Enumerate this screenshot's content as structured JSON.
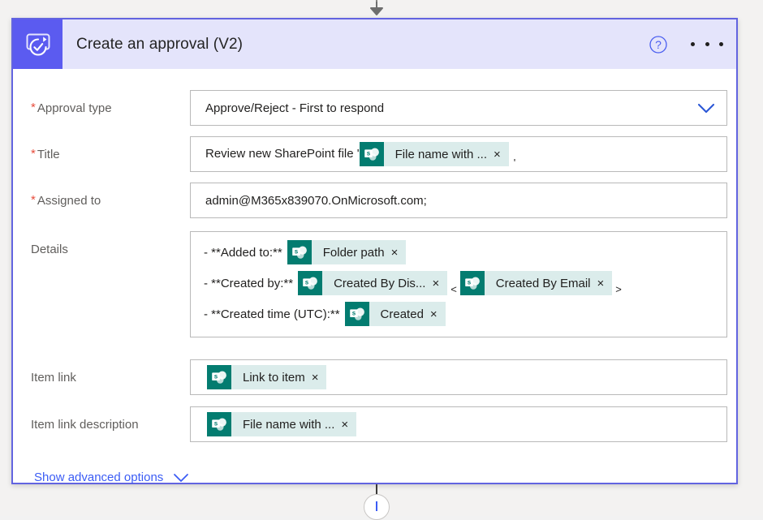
{
  "header": {
    "title": "Create an approval (V2)",
    "icon": "approvals-icon",
    "help_icon": "help-circle-icon",
    "more_icon": "more-horizontal-icon",
    "bg_color": "#e4e4fb",
    "icon_bg_color": "#5b5bf0"
  },
  "card": {
    "border_color": "#6264e0",
    "background": "#ffffff"
  },
  "fields": {
    "approval_type": {
      "label": "Approval type",
      "required": true,
      "value": "Approve/Reject - First to respond",
      "chevron_icon": "chevron-down-icon"
    },
    "title": {
      "label": "Title",
      "required": true,
      "prefix_text": "Review new SharePoint file '",
      "token": {
        "label": "File name with ...",
        "icon": "sharepoint-icon",
        "remove": "×"
      },
      "suffix_text": "'"
    },
    "assigned_to": {
      "label": "Assigned to",
      "required": true,
      "value": "admin@M365x839070.OnMicrosoft.com;"
    },
    "details": {
      "label": "Details",
      "required": false,
      "lines": [
        {
          "lead": "- **Added to:**",
          "tokens": [
            {
              "label": "Folder path",
              "icon": "sharepoint-icon",
              "remove": "×"
            }
          ],
          "between": "",
          "trailing": ""
        },
        {
          "lead": "- **Created by:**",
          "tokens": [
            {
              "label": "Created By Dis...",
              "icon": "sharepoint-icon",
              "remove": "×"
            },
            {
              "label": "Created By Email",
              "icon": "sharepoint-icon",
              "remove": "×"
            }
          ],
          "between": "<",
          "trailing": ">"
        },
        {
          "lead": "- **Created time (UTC):**",
          "tokens": [
            {
              "label": "Created",
              "icon": "sharepoint-icon",
              "remove": "×"
            }
          ],
          "between": "",
          "trailing": ""
        }
      ]
    },
    "item_link": {
      "label": "Item link",
      "required": false,
      "token": {
        "label": "Link to item",
        "icon": "sharepoint-icon",
        "remove": "×"
      }
    },
    "item_link_description": {
      "label": "Item link description",
      "required": false,
      "token": {
        "label": "File name with ...",
        "icon": "sharepoint-icon",
        "remove": "×"
      }
    }
  },
  "advanced_options": {
    "label": "Show advanced options",
    "chevron_icon": "chevron-down-icon",
    "color": "#3b5cf5"
  },
  "connectors": {
    "top_icon": "arrow-down-icon",
    "bottom_icon": "add-step-icon"
  },
  "colors": {
    "token_bg": "#dbeceb",
    "token_icon_bg": "#037c70",
    "required_star": "#e74c3c",
    "label_text": "#605e5c",
    "link": "#3b5cf5"
  }
}
